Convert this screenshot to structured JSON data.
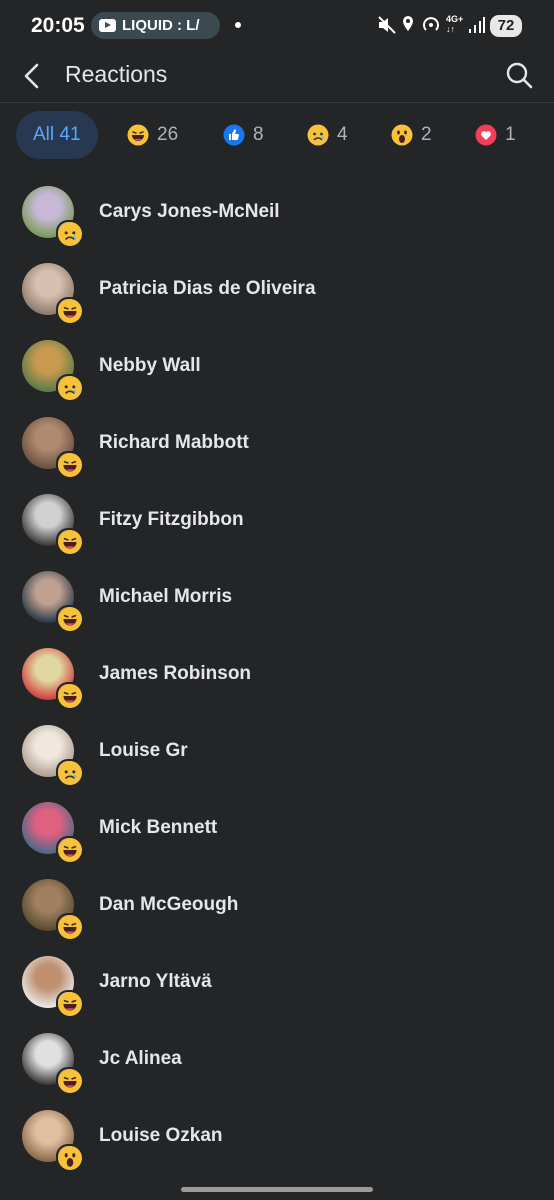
{
  "status_bar": {
    "time": "20:05",
    "media_text": "LIQUID : L/",
    "battery": "72"
  },
  "header": {
    "title": "Reactions"
  },
  "tabs": [
    {
      "label": "All 41",
      "active": true
    },
    {
      "emoji": "laugh",
      "count": "26"
    },
    {
      "emoji": "like",
      "count": "8"
    },
    {
      "emoji": "sad",
      "count": "4"
    },
    {
      "emoji": "wow",
      "count": "2"
    },
    {
      "emoji": "love",
      "count": "1"
    }
  ],
  "people": [
    {
      "name": "Carys Jones-McNeil",
      "reaction": "sad"
    },
    {
      "name": "Patricia Dias de Oliveira",
      "reaction": "laugh"
    },
    {
      "name": "Nebby Wall",
      "reaction": "sad"
    },
    {
      "name": "Richard Mabbott",
      "reaction": "laugh"
    },
    {
      "name": "Fitzy Fitzgibbon",
      "reaction": "laugh"
    },
    {
      "name": "Michael Morris",
      "reaction": "laugh"
    },
    {
      "name": "James Robinson",
      "reaction": "laugh"
    },
    {
      "name": "Louise Gr",
      "reaction": "sad"
    },
    {
      "name": "Mick Bennett",
      "reaction": "laugh"
    },
    {
      "name": "Dan McGeough",
      "reaction": "laugh"
    },
    {
      "name": "Jarno Yltävä",
      "reaction": "laugh"
    },
    {
      "name": "Jc Alinea",
      "reaction": "laugh"
    },
    {
      "name": "Louise Ozkan",
      "reaction": "wow"
    }
  ]
}
